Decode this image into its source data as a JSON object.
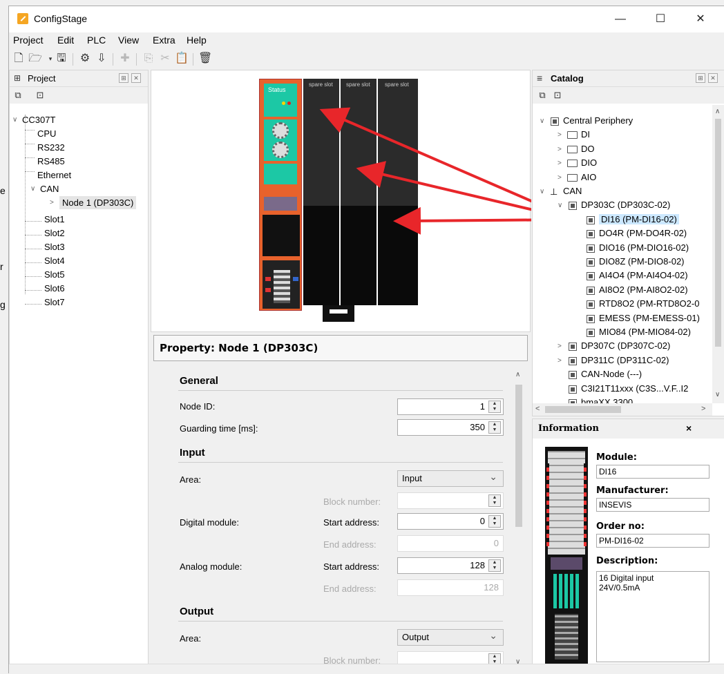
{
  "window": {
    "title": "ConfigStage",
    "controls": [
      "—",
      "☐",
      "✕"
    ]
  },
  "menu": [
    "Project",
    "Edit",
    "PLC",
    "View",
    "Extra",
    "Help"
  ],
  "edge_letters": [
    "e",
    "r",
    "g"
  ],
  "project_panel": {
    "title": "Project",
    "tree": [
      {
        "label": "CC307T",
        "level": 0
      },
      {
        "label": "CPU",
        "level": 1
      },
      {
        "label": "RS232",
        "level": 1
      },
      {
        "label": "RS485",
        "level": 1
      },
      {
        "label": "Ethernet",
        "level": 1
      },
      {
        "label": "CAN",
        "level": 1
      },
      {
        "label": "Node 1 (DP303C)",
        "level": 2
      },
      {
        "label": "Slot1",
        "level": 1
      },
      {
        "label": "Slot2",
        "level": 1
      },
      {
        "label": "Slot3",
        "level": 1
      },
      {
        "label": "Slot4",
        "level": 1
      },
      {
        "label": "Slot5",
        "level": 1
      },
      {
        "label": "Slot6",
        "level": 1
      },
      {
        "label": "Slot7",
        "level": 1
      }
    ]
  },
  "hardware": {
    "slots": [
      "spare slot",
      "spare slot",
      "spare slot"
    ],
    "module_label": "Status"
  },
  "property": {
    "title": "Property: Node 1 (DP303C)",
    "general": {
      "title": "General",
      "node_id_label": "Node ID:",
      "node_id": "1",
      "guarding_label": "Guarding time [ms]:",
      "guarding": "350"
    },
    "input": {
      "title": "Input",
      "area_label": "Area:",
      "area": "Input",
      "block_label": "Block number:",
      "block": "",
      "digital_label": "Digital module:",
      "start_label": "Start address:",
      "digital_start": "0",
      "end_label": "End address:",
      "digital_end": "0",
      "analog_label": "Analog module:",
      "analog_start": "128",
      "analog_end": "128"
    },
    "output": {
      "title": "Output",
      "area_label": "Area:",
      "area": "Output",
      "block_label": "Block number:",
      "block": ""
    }
  },
  "catalog": {
    "title": "Catalog",
    "tree": [
      {
        "label": "Central Periphery",
        "icon": "module"
      },
      {
        "label": "DI",
        "icon": "folder"
      },
      {
        "label": "DO",
        "icon": "folder"
      },
      {
        "label": "DIO",
        "icon": "folder"
      },
      {
        "label": "AIO",
        "icon": "folder"
      },
      {
        "label": "CAN",
        "icon": "network"
      },
      {
        "label": "DP303C (DP303C-02)",
        "icon": "module"
      },
      {
        "label": "DI16 (PM-DI16-02)",
        "icon": "module",
        "selected": true
      },
      {
        "label": "DO4R (PM-DO4R-02)",
        "icon": "module"
      },
      {
        "label": "DIO16 (PM-DIO16-02)",
        "icon": "module"
      },
      {
        "label": "DIO8Z (PM-DIO8-02)",
        "icon": "module"
      },
      {
        "label": "AI4O4 (PM-AI4O4-02)",
        "icon": "module"
      },
      {
        "label": "AI8O2 (PM-AI8O2-02)",
        "icon": "module"
      },
      {
        "label": "RTD8O2 (PM-RTD8O2-0",
        "icon": "module"
      },
      {
        "label": "EMESS (PM-EMESS-01)",
        "icon": "module"
      },
      {
        "label": "MIO84 (PM-MIO84-02)",
        "icon": "module"
      },
      {
        "label": "DP307C (DP307C-02)",
        "icon": "module"
      },
      {
        "label": "DP311C (DP311C-02)",
        "icon": "module"
      },
      {
        "label": "CAN-Node (---)",
        "icon": "module"
      },
      {
        "label": "C3I21T11xxx (C3S...V.F..I2",
        "icon": "module"
      },
      {
        "label": "bmaXX 3300",
        "icon": "module"
      }
    ]
  },
  "information": {
    "title": "Information",
    "module_label": "Module:",
    "module": "DI16",
    "manufacturer_label": "Manufacturer:",
    "manufacturer": "INSEVIS",
    "order_label": "Order no:",
    "order": "PM-DI16-02",
    "description_label": "Description:",
    "description_1": "16 Digital input",
    "description_2": "24V/0.5mA"
  },
  "colors": {
    "arrow": "#e8262a",
    "module_orange": "#e8622c",
    "module_green": "#1cc8a5",
    "slot_dark": "#2b2b2b",
    "selection": "#cce8ff"
  }
}
